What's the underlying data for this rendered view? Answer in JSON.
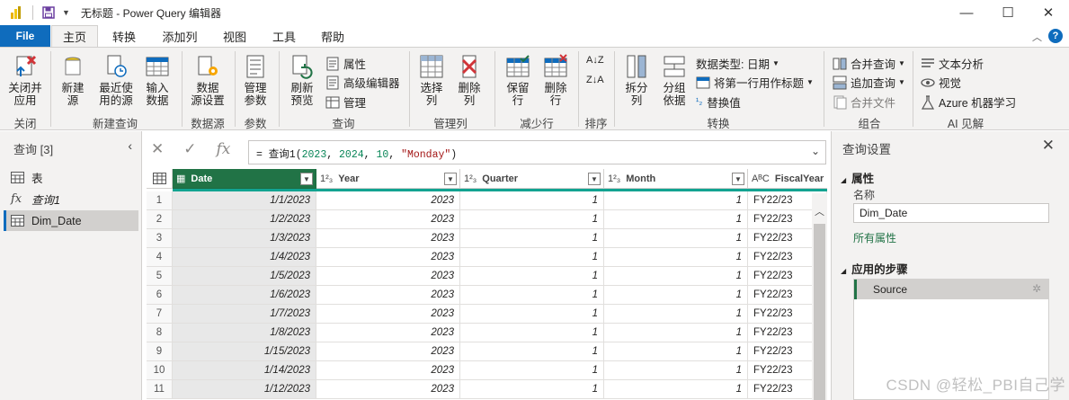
{
  "titlebar": {
    "title": "无标题 - Power Query 编辑器",
    "minimize": "—",
    "maximize": "☐",
    "close": "✕"
  },
  "tabs": {
    "file": "File",
    "items": [
      "主页",
      "转换",
      "添加列",
      "视图",
      "工具",
      "帮助"
    ],
    "active": "主页",
    "collapse_ribbon": "︿",
    "help": "?"
  },
  "ribbon": {
    "close_apply": "关闭并\n应用",
    "group_close": "关闭",
    "new_source": "新建\n源",
    "recent_sources": "最近使\n用的源",
    "enter_data": "输入\n数据",
    "group_new_query": "新建查询",
    "data_source_settings": "数据\n源设置",
    "group_data_source": "数据源",
    "manage_params": "管理\n参数",
    "group_params": "参数",
    "refresh_preview": "刷新\n预览",
    "properties": "属性",
    "advanced_editor": "高级编辑器",
    "manage": "管理",
    "group_query": "查询",
    "choose_columns": "选择\n列",
    "remove_columns": "删除\n列",
    "group_manage_columns": "管理列",
    "keep_rows": "保留\n行",
    "remove_rows": "删除\n行",
    "group_reduce_rows": "减少行",
    "group_sort": "排序",
    "split_column": "拆分\n列",
    "group_by": "分组\n依据",
    "data_type": "数据类型: 日期",
    "use_first_row": "将第一行用作标题",
    "replace_values": "替换值",
    "group_transform": "转换",
    "merge_queries": "合并查询",
    "append_queries": "追加查询",
    "combine_files": "合并文件",
    "group_combine": "组合",
    "text_analytics": "文本分析",
    "vision": "视觉",
    "azure_ml": "Azure 机器学习",
    "group_ai": "AI 见解"
  },
  "queries_pane": {
    "header": "查询 [3]",
    "collapse": "‹",
    "items": [
      {
        "label": "表",
        "type": "table"
      },
      {
        "label": "查询1",
        "type": "function"
      },
      {
        "label": "Dim_Date",
        "type": "table",
        "selected": true
      }
    ]
  },
  "formula_bar": {
    "cancel": "✕",
    "commit": "✓",
    "fx": "fx",
    "prefix": "= 查询1(",
    "arg1": "2023",
    "arg2": "2024",
    "arg3": "10",
    "arg4": "\"Monday\"",
    "suffix": ")",
    "expand": "⌄"
  },
  "grid": {
    "columns": [
      {
        "name": "Date",
        "type_icon": "▦",
        "selected": true
      },
      {
        "name": "Year",
        "type_icon": "1²₃"
      },
      {
        "name": "Quarter",
        "type_icon": "1²₃"
      },
      {
        "name": "Month",
        "type_icon": "1²₃"
      },
      {
        "name": "FiscalYear",
        "type_icon": "AᴮC"
      }
    ],
    "rows": [
      [
        "1",
        "1/1/2023",
        "2023",
        "1",
        "1",
        "FY22/23"
      ],
      [
        "2",
        "1/2/2023",
        "2023",
        "1",
        "1",
        "FY22/23"
      ],
      [
        "3",
        "1/3/2023",
        "2023",
        "1",
        "1",
        "FY22/23"
      ],
      [
        "4",
        "1/4/2023",
        "2023",
        "1",
        "1",
        "FY22/23"
      ],
      [
        "5",
        "1/5/2023",
        "2023",
        "1",
        "1",
        "FY22/23"
      ],
      [
        "6",
        "1/6/2023",
        "2023",
        "1",
        "1",
        "FY22/23"
      ],
      [
        "7",
        "1/7/2023",
        "2023",
        "1",
        "1",
        "FY22/23"
      ],
      [
        "8",
        "1/8/2023",
        "2023",
        "1",
        "1",
        "FY22/23"
      ],
      [
        "9",
        "1/15/2023",
        "2023",
        "1",
        "1",
        "FY22/23"
      ],
      [
        "10",
        "1/14/2023",
        "2023",
        "1",
        "1",
        "FY22/23"
      ],
      [
        "11",
        "1/12/2023",
        "2023",
        "1",
        "1",
        "FY22/23"
      ]
    ]
  },
  "settings_pane": {
    "title": "查询设置",
    "close": "✕",
    "properties_header": "属性",
    "name_label": "名称",
    "name_value": "Dim_Date",
    "all_properties": "所有属性",
    "applied_steps_header": "应用的步骤",
    "steps": [
      "Source"
    ]
  },
  "watermark": "CSDN @轻松_PBI自己学",
  "colors": {
    "accent_blue": "#0f6cbd",
    "accent_green": "#217346",
    "quality_bar": "#12a391"
  }
}
